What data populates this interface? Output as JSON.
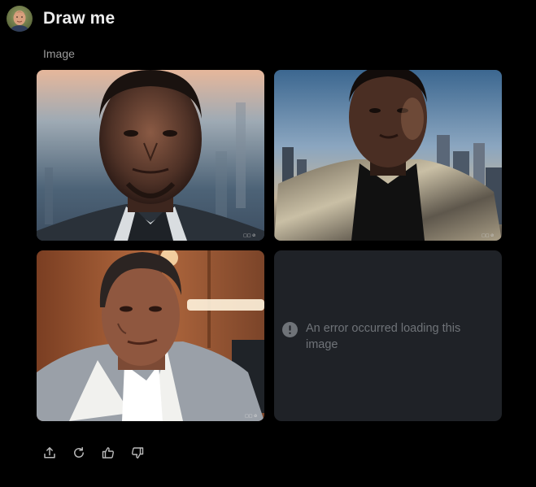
{
  "post": {
    "title": "Draw me",
    "subtitle": "Image"
  },
  "images": {
    "error_message": "An error occurred loading this image"
  },
  "actions": [
    {
      "icon": "share-icon"
    },
    {
      "icon": "regenerate-icon"
    },
    {
      "icon": "thumbs-up-icon"
    },
    {
      "icon": "thumbs-down-icon"
    }
  ],
  "colors": {
    "background": "#000000",
    "tile_placeholder": "#1f2227",
    "text_primary": "#ececec",
    "text_muted": "#9a9a9a",
    "icon": "#b9b9b9"
  }
}
